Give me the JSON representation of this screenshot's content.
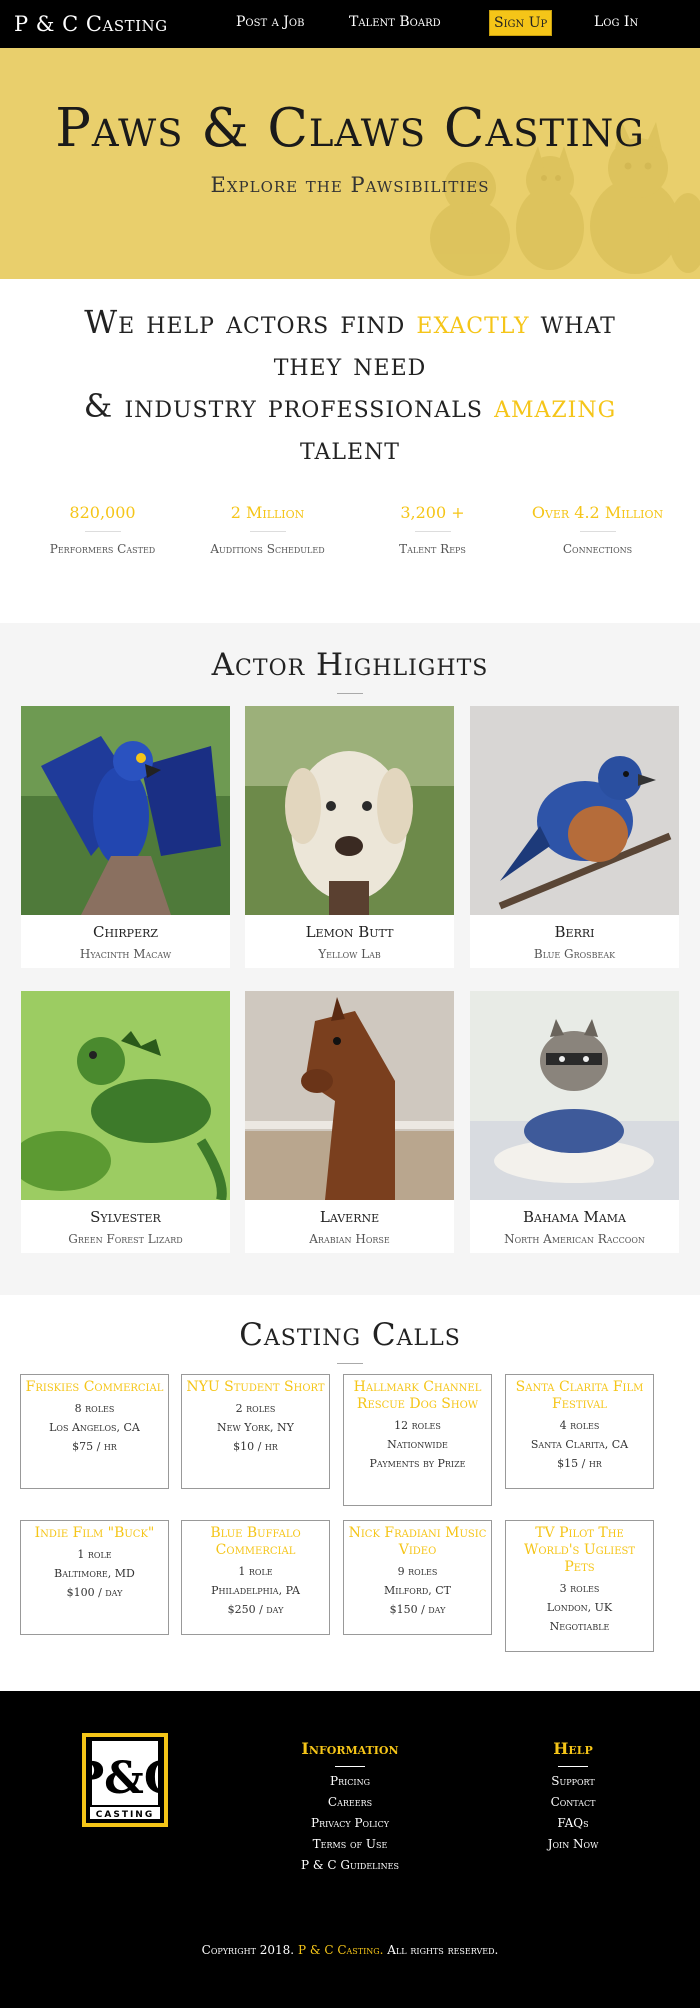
{
  "nav": {
    "brand": "P & C Casting",
    "links": [
      "Post a Job",
      "Talent Board"
    ],
    "signup": "Sign Up",
    "login": "Log In"
  },
  "hero": {
    "title": "Paws & Claws Casting",
    "subtitle": "Explore the Pawsibilities"
  },
  "help": {
    "line1_a": "We help actors find ",
    "line1_accent": "exactly",
    "line1_b": " what",
    "line2": "they need",
    "line3_a": "& industry professionals ",
    "line3_accent": "amazing",
    "line4": "talent"
  },
  "stats": [
    {
      "value": "820,000",
      "label": "Performers Casted"
    },
    {
      "value": "2 Million",
      "label": "Auditions Scheduled"
    },
    {
      "value": "3,200 +",
      "label": "Talent Reps"
    },
    {
      "value": "Over 4.2 Million",
      "label": "Connections"
    }
  ],
  "actors": {
    "title": "Actor Highlights",
    "cards": [
      {
        "name": "Chirperz",
        "breed": "Hyacinth Macaw"
      },
      {
        "name": "Lemon Butt",
        "breed": "Yellow Lab"
      },
      {
        "name": "Berri",
        "breed": "Blue Grosbeak"
      },
      {
        "name": "Sylvester",
        "breed": "Green Forest Lizard"
      },
      {
        "name": "Laverne",
        "breed": "Arabian Horse"
      },
      {
        "name": "Bahama Mama",
        "breed": "North American Raccoon"
      }
    ]
  },
  "casting": {
    "title": "Casting Calls",
    "calls": [
      {
        "title": "Friskies Commercial",
        "lines": [
          "8 roles",
          "Los Angelos, CA",
          "$75 / hr"
        ]
      },
      {
        "title": "NYU Student Short",
        "lines": [
          "2 roles",
          "New York, NY",
          "$10 / hr"
        ]
      },
      {
        "title": "Hallmark Channel Rescue Dog Show",
        "lines": [
          "12 roles",
          "Nationwide",
          "Payments by Prize"
        ]
      },
      {
        "title": "Santa Clarita Film Festival",
        "lines": [
          "4 roles",
          "Santa Clarita, CA",
          "$15 / hr"
        ]
      },
      {
        "title": "Indie Film \"Buck\"",
        "lines": [
          "1 role",
          "Baltimore, MD",
          "$100 / day"
        ]
      },
      {
        "title": "Blue Buffalo Commercial",
        "lines": [
          "1 role",
          "Philadelphia, PA",
          "$250 / day"
        ]
      },
      {
        "title": "Nick Fradiani Music Video",
        "lines": [
          "9 roles",
          "Milford, CT",
          "$150 / day"
        ]
      },
      {
        "title": "TV Pilot The World's Ugliest Pets",
        "lines": [
          "3 roles",
          "London, UK",
          "Negotiable"
        ]
      }
    ]
  },
  "footer": {
    "logo_text": "P&C",
    "logo_sub": "CASTING",
    "info_title": "Information",
    "info_links": [
      "Pricing",
      "Careers",
      "Privacy Policy",
      "Terms of Use",
      "P & C Guidelines"
    ],
    "help_title": "Help",
    "help_links": [
      "Support",
      "Contact",
      "FAQs",
      "Join Now"
    ],
    "copyright_a": "Copyright 2018. ",
    "copyright_accent": "P & C Casting.",
    "copyright_b": " All rights reserved."
  },
  "colors": {
    "accent": "#f5c518",
    "hero_bg": "#e9cf6c",
    "nav_bg": "#000000"
  }
}
